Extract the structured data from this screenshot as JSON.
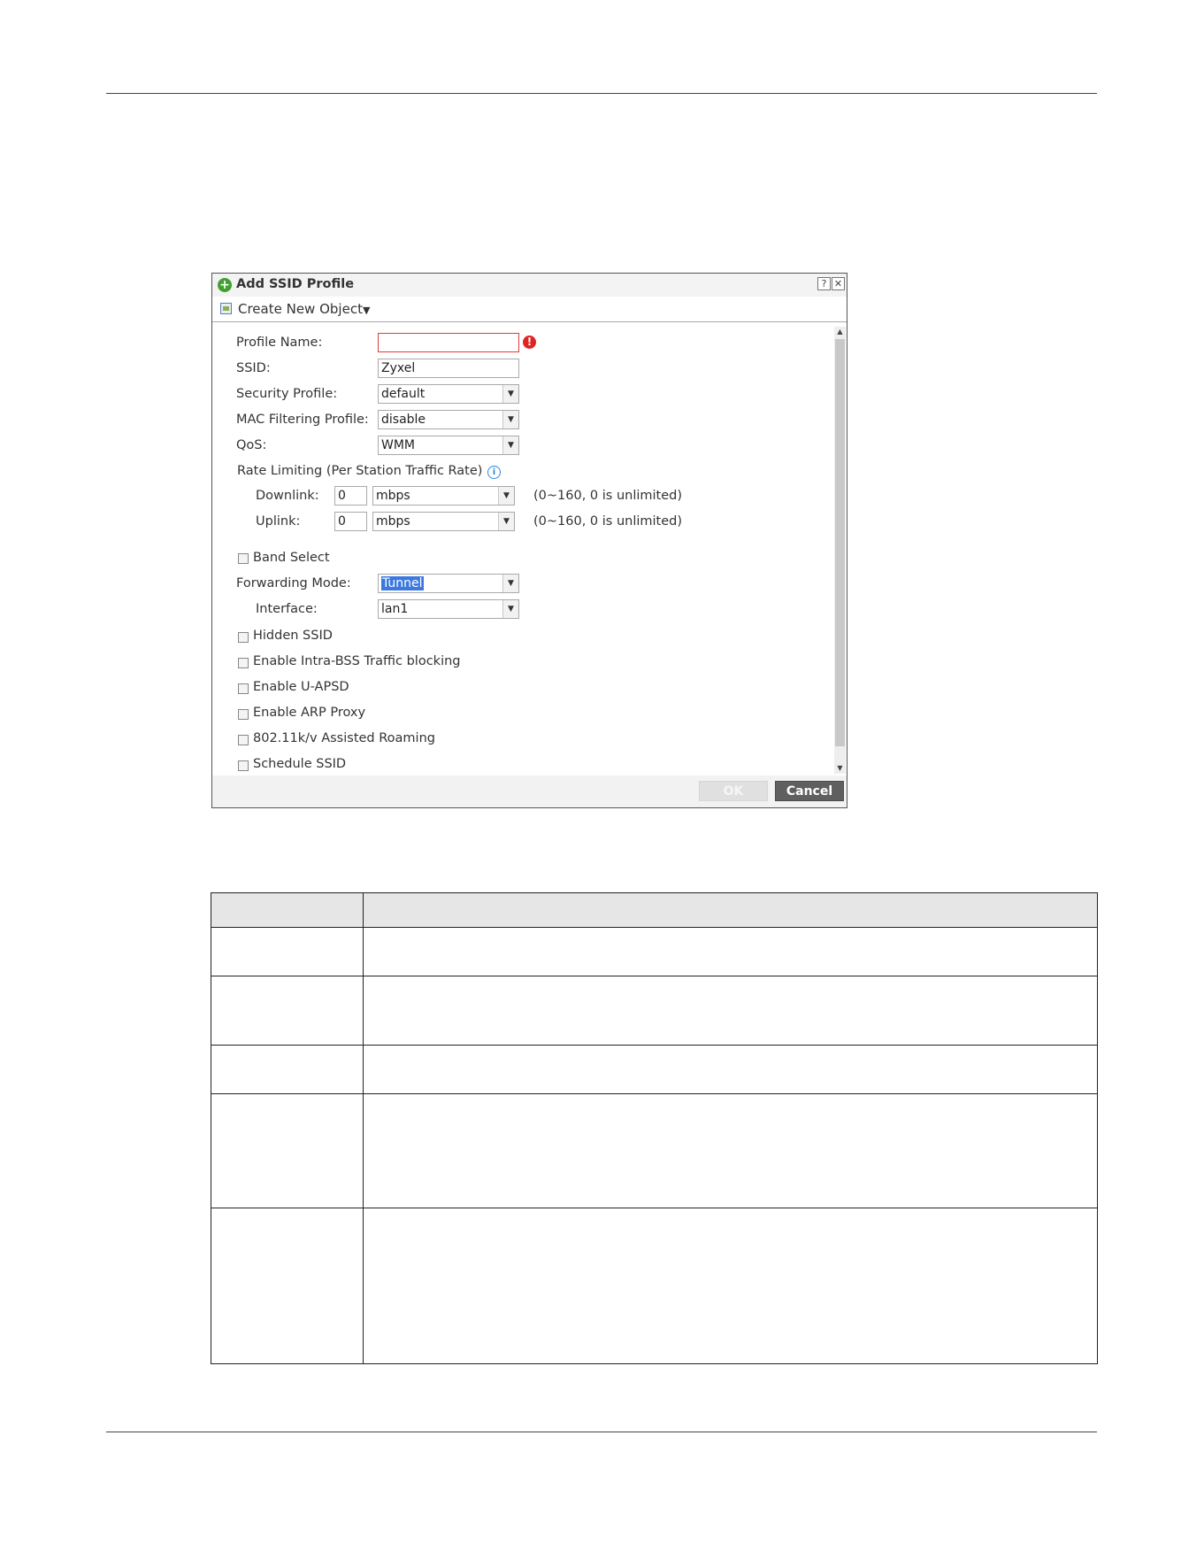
{
  "dialog": {
    "title": "Add SSID Profile",
    "help_glyph": "?",
    "close_glyph": "✕",
    "toolbar_label": "Create New Object",
    "toolbar_caret": "▼"
  },
  "form": {
    "profile_name_label": "Profile Name:",
    "profile_name_value": "",
    "ssid_label": "SSID:",
    "ssid_value": "Zyxel",
    "security_profile_label": "Security Profile:",
    "security_profile_value": "default",
    "mac_filtering_label": "MAC Filtering Profile:",
    "mac_filtering_value": "disable",
    "qos_label": "QoS:",
    "qos_value": "WMM",
    "rate_limiting_label": "Rate Limiting (Per Station Traffic Rate)",
    "downlink_label": "Downlink:",
    "downlink_value": "0",
    "downlink_unit": "mbps",
    "downlink_hint": "(0~160, 0 is unlimited)",
    "uplink_label": "Uplink:",
    "uplink_value": "0",
    "uplink_unit": "mbps",
    "uplink_hint": "(0~160, 0 is unlimited)",
    "band_select_label": "Band Select",
    "forwarding_mode_label": "Forwarding Mode:",
    "forwarding_mode_value": "Tunnel",
    "interface_label": "Interface:",
    "interface_value": "lan1",
    "hidden_ssid_label": "Hidden SSID",
    "intra_bss_label": "Enable Intra-BSS Traffic blocking",
    "uapsd_label": "Enable U-APSD",
    "arp_proxy_label": "Enable ARP Proxy",
    "roaming_label": "802.11k/v Assisted Roaming",
    "schedule_label": "Schedule SSID"
  },
  "buttons": {
    "ok": "OK",
    "cancel": "Cancel"
  },
  "colors": {
    "error_red": "#e02323",
    "accent_green": "#3fa02f",
    "info_blue": "#2b8ad8",
    "highlight_blue": "#3b78e0"
  }
}
